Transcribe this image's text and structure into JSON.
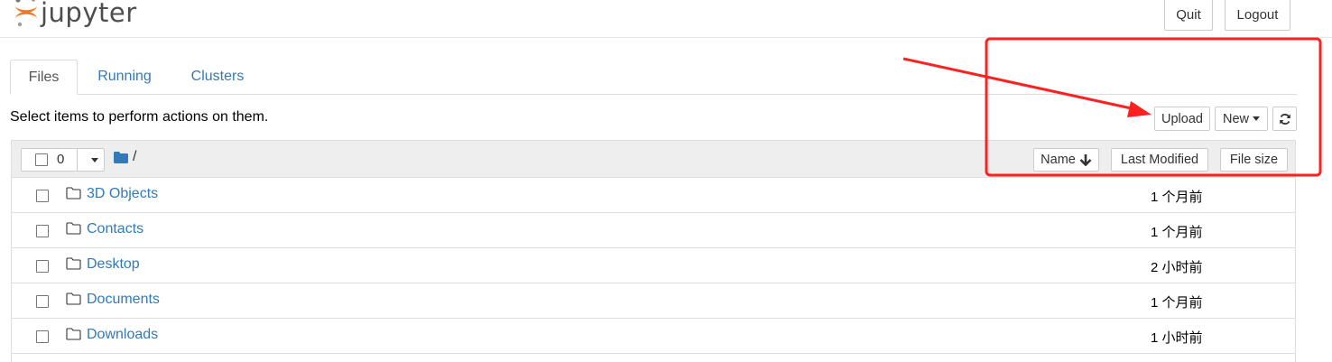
{
  "header": {
    "logo_text": "jupyter",
    "quit_label": "Quit",
    "logout_label": "Logout"
  },
  "tabs": [
    {
      "label": "Files",
      "active": true
    },
    {
      "label": "Running",
      "active": false
    },
    {
      "label": "Clusters",
      "active": false
    }
  ],
  "toolbar": {
    "instruction": "Select items to perform actions on them.",
    "upload_label": "Upload",
    "new_label": "New",
    "refresh_icon": "refresh-icon"
  },
  "list_header": {
    "selected_count": "0",
    "breadcrumb": "/",
    "sort_name_label": "Name",
    "sort_name_icon": "arrow-down-icon",
    "last_modified_label": "Last Modified",
    "file_size_label": "File size"
  },
  "files": [
    {
      "name": "3D Objects",
      "modified": "1 个月前",
      "icon": "folder-icon"
    },
    {
      "name": "Contacts",
      "modified": "1 个月前",
      "icon": "folder-icon"
    },
    {
      "name": "Desktop",
      "modified": "2 小时前",
      "icon": "folder-icon"
    },
    {
      "name": "Documents",
      "modified": "1 个月前",
      "icon": "folder-icon"
    },
    {
      "name": "Downloads",
      "modified": "1 小时前",
      "icon": "folder-icon"
    }
  ],
  "colors": {
    "link": "#337ab7",
    "jupyter_orange": "#f37726",
    "annotation_red": "#ff2020"
  }
}
